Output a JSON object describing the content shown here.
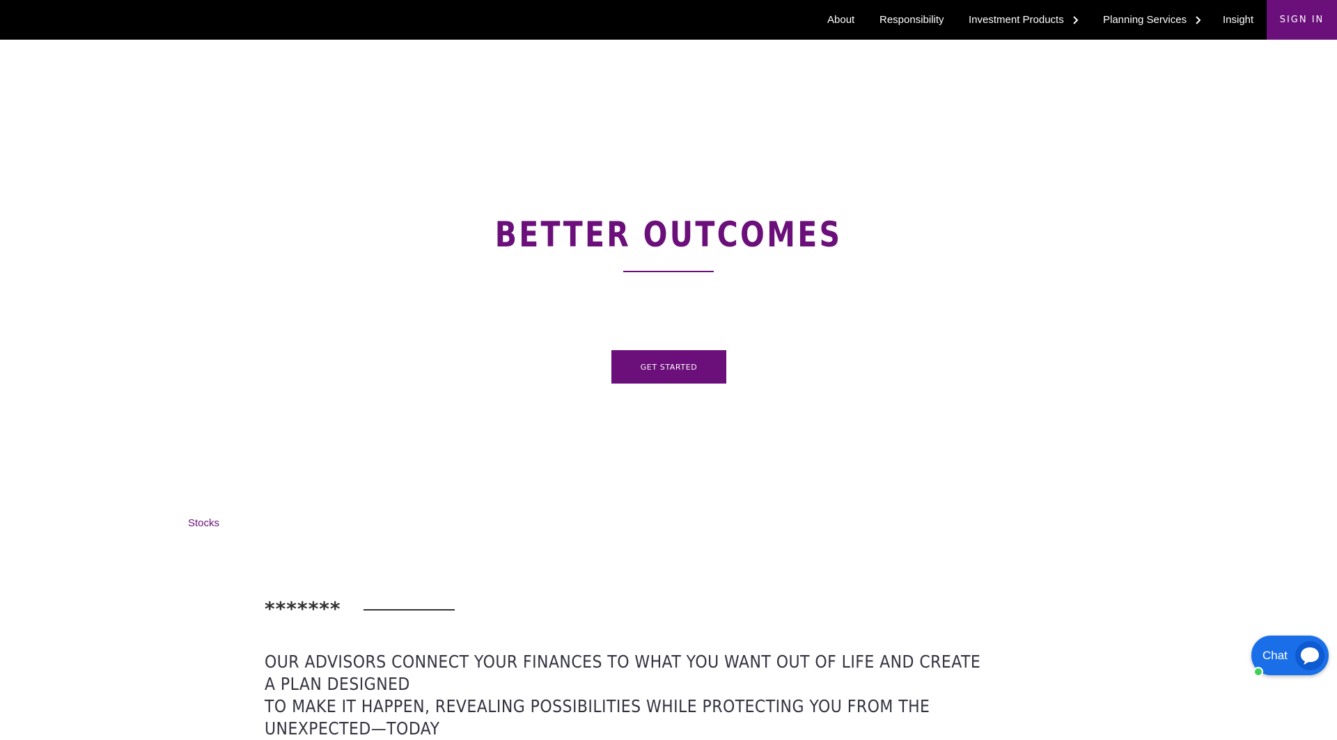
{
  "colors": {
    "brand_purple": "#6b0f7a",
    "nav_background": "#000000",
    "chat_blue": "#1a6fe8",
    "chat_bubble": "#0d5ad1",
    "online_green": "#3ecf5a"
  },
  "nav": {
    "items": [
      {
        "label": "About"
      },
      {
        "label": "Responsibility"
      },
      {
        "label": "Investment Products",
        "icon": "chevron-right-icon"
      },
      {
        "label": "Planning Services",
        "icon": "chevron-right-icon"
      },
      {
        "label": "Insight"
      }
    ],
    "sign_in_label": "SIGN IN"
  },
  "hero": {
    "title": "BETTER OUTCOMES",
    "cta_label": "GET STARTED"
  },
  "stocks_link": "Stocks",
  "stars_text": "*******",
  "body_text_lines": [
    "OUR ADVISORS CONNECT YOUR FINANCES TO WHAT YOU WANT OUT OF LIFE AND CREATE A PLAN DESIGNED",
    "TO MAKE IT HAPPEN, REVEALING POSSIBILITIES WHILE PROTECTING YOU FROM THE UNEXPECTED—TODAY"
  ],
  "chat": {
    "label": "Chat",
    "icon": "speech-bubble-icon"
  }
}
